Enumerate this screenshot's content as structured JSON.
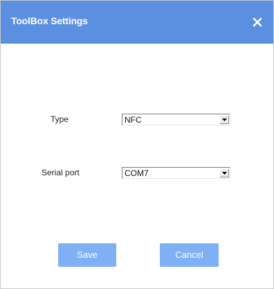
{
  "dialog": {
    "title": "ToolBox Settings",
    "close_icon": "close-icon",
    "accent_color": "#5b8fe0",
    "button_color": "#7fb0f5"
  },
  "form": {
    "type_label": "Type",
    "type_value": "NFC",
    "serial_port_label": "Serial port",
    "serial_port_value": "COM7"
  },
  "buttons": {
    "save_label": "Save",
    "cancel_label": "Cancel"
  }
}
